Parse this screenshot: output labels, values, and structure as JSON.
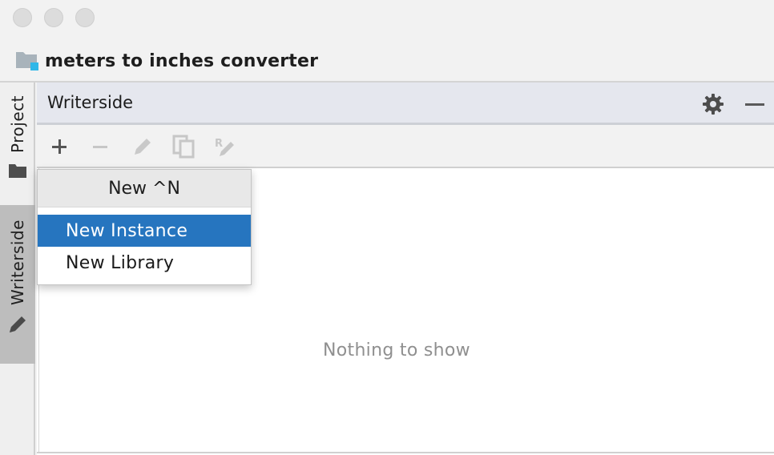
{
  "window": {
    "project_title": "meters to inches converter"
  },
  "left_strip": {
    "tabs": [
      {
        "label": "Project",
        "icon": "folder-icon"
      },
      {
        "label": "Writerside",
        "icon": "pencil-icon"
      }
    ]
  },
  "tool_window": {
    "title": "Writerside",
    "header_icons": [
      "gear-icon",
      "minimize-icon"
    ],
    "toolbar_icons": [
      "add-icon",
      "remove-icon",
      "edit-icon",
      "copy-icon",
      "rename-icon"
    ],
    "empty_text": "Nothing to show"
  },
  "popup": {
    "title": "New ^N",
    "items": [
      {
        "label": "New Instance",
        "selected": true
      },
      {
        "label": "New Library",
        "selected": false
      }
    ]
  },
  "colors": {
    "selection": "#2675bf",
    "project_icon_accent": "#2fb7e8"
  }
}
